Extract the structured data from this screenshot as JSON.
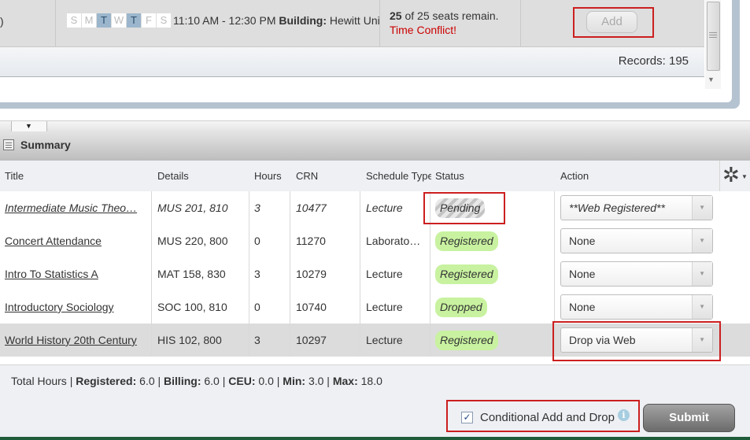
{
  "results": {
    "row_prefix": ")",
    "days": [
      {
        "letter": "S",
        "active": false
      },
      {
        "letter": "M",
        "active": false
      },
      {
        "letter": "T",
        "active": true
      },
      {
        "letter": "W",
        "active": false
      },
      {
        "letter": "T",
        "active": true
      },
      {
        "letter": "F",
        "active": false
      },
      {
        "letter": "S",
        "active": false
      }
    ],
    "time": "11:10 AM - 12:30 PM",
    "building_label": "Building:",
    "building_value": "Hewitt Union",
    "seats_remaining": "25",
    "seats_text": "of 25 seats remain.",
    "conflict_text": "Time Conflict!",
    "add_label": "Add",
    "records_label": "Records: 195"
  },
  "summary": {
    "title": "Summary",
    "columns": {
      "title": "Title",
      "details": "Details",
      "hours": "Hours",
      "crn": "CRN",
      "schedule_type": "Schedule Type",
      "status": "Status",
      "action": "Action"
    },
    "rows": [
      {
        "title": "Intermediate Music Theo…",
        "details": "MUS 201, 810",
        "hours": "3",
        "crn": "10477",
        "schedule_type": "Lecture",
        "status": "Pending",
        "action": "**Web Registered**",
        "pending": true
      },
      {
        "title": "Concert Attendance",
        "details": "MUS 220, 800",
        "hours": "0",
        "crn": "11270",
        "schedule_type": "Laborato…",
        "status": "Registered",
        "action": "None"
      },
      {
        "title": "Intro To Statistics A",
        "details": "MAT 158, 830",
        "hours": "3",
        "crn": "10279",
        "schedule_type": "Lecture",
        "status": "Registered",
        "action": "None"
      },
      {
        "title": "Introductory Sociology",
        "details": "SOC 100, 810",
        "hours": "0",
        "crn": "10740",
        "schedule_type": "Lecture",
        "status": "Dropped",
        "action": "None"
      },
      {
        "title": "World History 20th Century",
        "details": "HIS 102, 800",
        "hours": "3",
        "crn": "10297",
        "schedule_type": "Lecture",
        "status": "Registered",
        "action": "Drop via Web",
        "highlighted": true
      }
    ]
  },
  "footer": {
    "total_hours_label": "Total Hours",
    "registered_label": "Registered:",
    "registered_value": "6.0",
    "billing_label": "Billing:",
    "billing_value": "6.0",
    "ceu_label": "CEU:",
    "ceu_value": "0.0",
    "min_label": "Min:",
    "min_value": "3.0",
    "max_label": "Max:",
    "max_value": "18.0",
    "conditional_label": "Conditional Add and Drop",
    "conditional_checked": true,
    "submit_label": "Submit"
  },
  "colors": {
    "highlight_box": "#cc1f1f",
    "conflict_text": "#cc0000",
    "registered_badge": "#c8f2a0",
    "active_day": "#9bb6cc"
  }
}
